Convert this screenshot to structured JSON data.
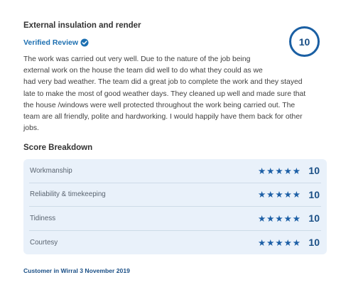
{
  "review": {
    "title": "External insulation and render",
    "verified_label": "Verified Review",
    "score": "10",
    "lines": [
      "The work was carried out very well. Due to the nature of the job being",
      "external work on the house the team did well to do what they could as we",
      "had very bad weather. The team did a great job to complete the work and they stayed",
      "late to make the most of good weather days. They cleaned up well and made sure that",
      "the house /windows were well protected throughout the work being carried out. The",
      "team are all friendly, polite and hardworking. I would happily have them back for other",
      "jobs."
    ]
  },
  "breakdown": {
    "heading": "Score Breakdown",
    "items": [
      {
        "label": "Workmanship",
        "stars": "★★★★★",
        "score": "10"
      },
      {
        "label": "Reliability & timekeeping",
        "stars": "★★★★★",
        "score": "10"
      },
      {
        "label": "Tidiness",
        "stars": "★★★★★",
        "score": "10"
      },
      {
        "label": "Courtesy",
        "stars": "★★★★★",
        "score": "10"
      }
    ]
  },
  "footer": {
    "customer": "Customer in Wirral 3 November 2019"
  },
  "colors": {
    "accent": "#1c6fb1",
    "score_blue": "#1a4f86",
    "breakdown_bg": "#e9f1fa"
  },
  "icons": {
    "verified": "check-badge-icon",
    "star": "star-icon"
  }
}
